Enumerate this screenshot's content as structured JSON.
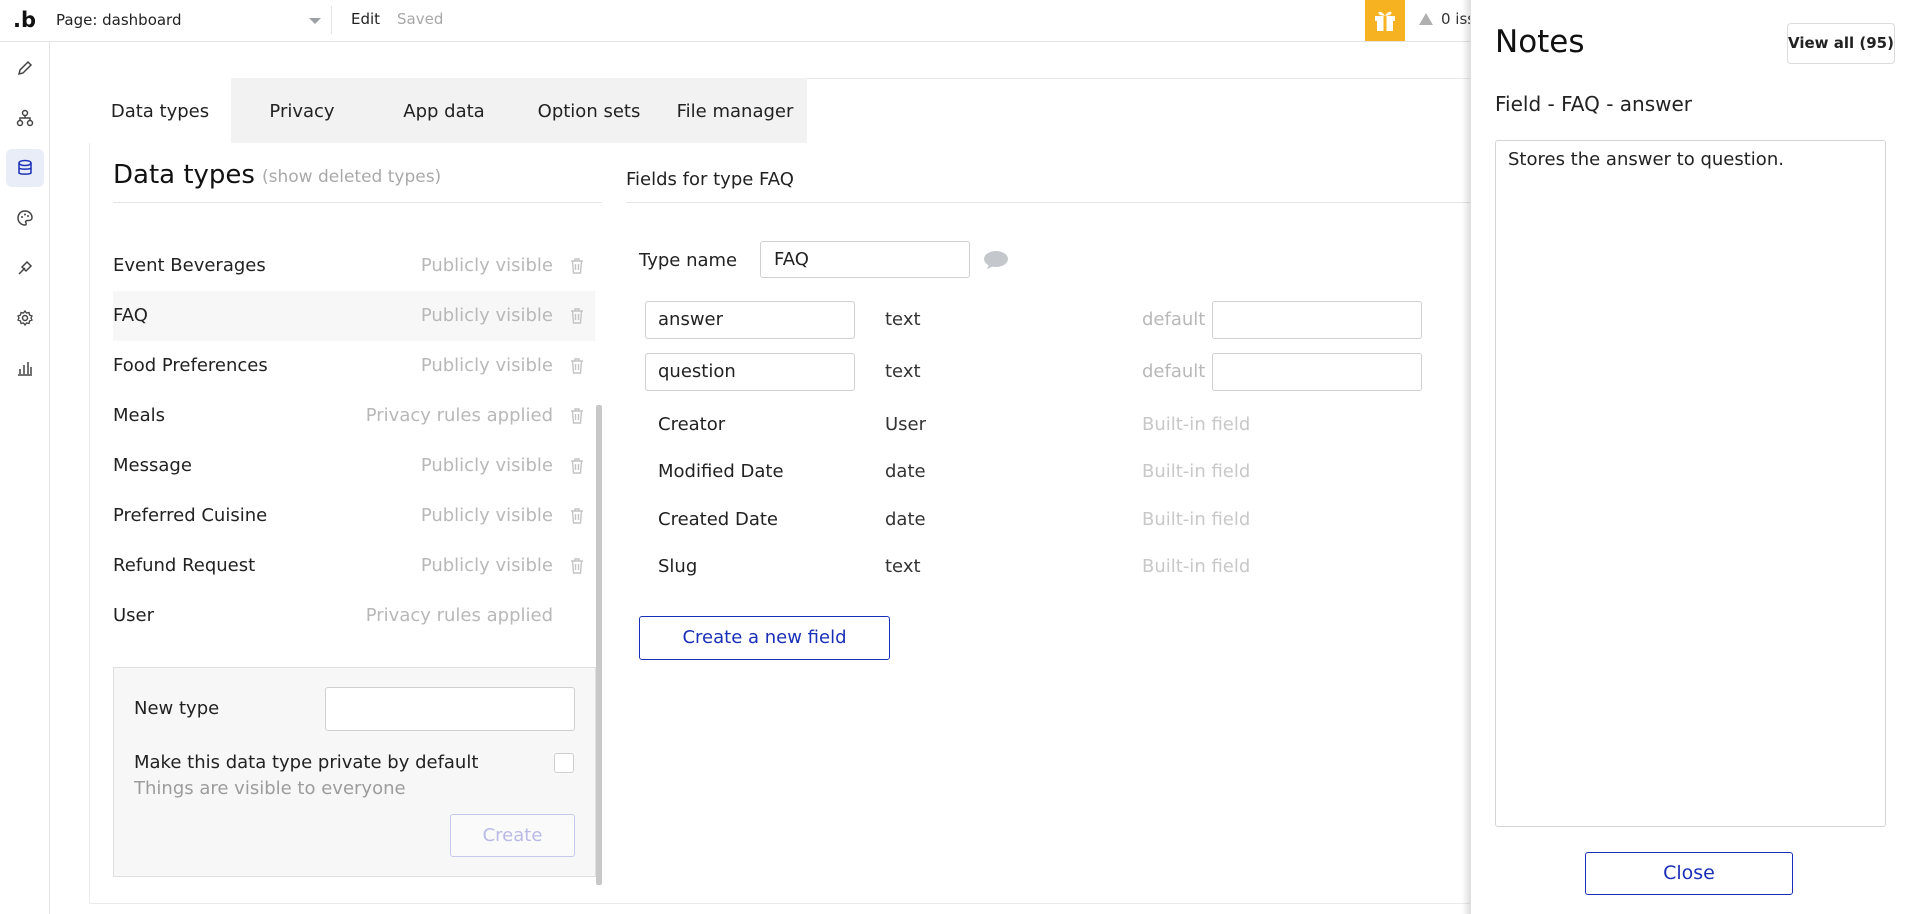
{
  "topbar": {
    "logo": ".b",
    "page_select": "Page: dashboard",
    "edit": "Edit",
    "saved": "Saved",
    "issues": "0 iss"
  },
  "leftbar": {
    "icons": [
      "pencil-icon",
      "workflow-icon",
      "database-icon",
      "palette-icon",
      "plugin-icon",
      "settings-icon",
      "chart-icon"
    ],
    "active": "database-icon"
  },
  "tabs": [
    {
      "label": "Data types",
      "active": true
    },
    {
      "label": "Privacy"
    },
    {
      "label": "App data"
    },
    {
      "label": "Option sets"
    },
    {
      "label": "File manager"
    }
  ],
  "data_types": {
    "title": "Data types",
    "show_deleted": "(show deleted types)",
    "items": [
      {
        "name": "Event Beverages",
        "privacy": "Publicly visible"
      },
      {
        "name": "FAQ",
        "privacy": "Publicly visible",
        "selected": true
      },
      {
        "name": "Food Preferences",
        "privacy": "Publicly visible"
      },
      {
        "name": "Meals",
        "privacy": "Privacy rules applied"
      },
      {
        "name": "Message",
        "privacy": "Publicly visible"
      },
      {
        "name": "Preferred Cuisine",
        "privacy": "Publicly visible"
      },
      {
        "name": "Refund Request",
        "privacy": "Publicly visible"
      },
      {
        "name": "User",
        "privacy": "Privacy rules applied"
      }
    ],
    "new_type": {
      "label": "New type",
      "input_value": "",
      "private_label": "Make this data type private by default",
      "private_sub": "Things are visible to everyone",
      "create_label": "Create"
    }
  },
  "fields": {
    "title": "Fields for type FAQ",
    "type_name_label": "Type name",
    "type_name_value": "FAQ",
    "rows": [
      {
        "name": "answer",
        "type": "text",
        "extra": "default",
        "editable": true
      },
      {
        "name": "question",
        "type": "text",
        "extra": "default",
        "editable": true
      },
      {
        "name": "Creator",
        "type": "User",
        "extra": "Built-in field"
      },
      {
        "name": "Modified Date",
        "type": "date",
        "extra": "Built-in field"
      },
      {
        "name": "Created Date",
        "type": "date",
        "extra": "Built-in field"
      },
      {
        "name": "Slug",
        "type": "text",
        "extra": "Built-in field"
      }
    ],
    "create_field_label": "Create a new field"
  },
  "notes": {
    "title": "Notes",
    "view_all": "View all (95)",
    "field_label": "Field - FAQ - answer",
    "text": "Stores the answer to question.",
    "close_label": "Close"
  },
  "colors": {
    "accent": "#1a2fb8",
    "gift": "#f7b222",
    "muted": "#b8b8b8"
  }
}
